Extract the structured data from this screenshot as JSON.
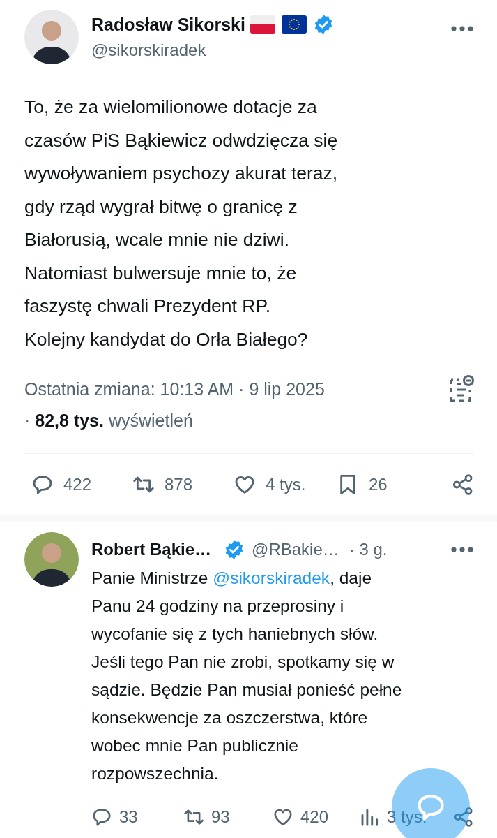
{
  "main_post": {
    "author": {
      "name": "Radosław Sikorski",
      "flags": [
        {
          "kind": "pl"
        },
        {
          "kind": "eu"
        }
      ],
      "verified": true,
      "handle": "@sikorskiradek"
    },
    "text": "To, że za wielomilionowe dotacje za\nczasów PiS Bąkiewicz odwdzięcza się\nwywoływaniem psychozy akurat teraz,\ngdy rząd wygrał bitwę o granicę z\nBiałorusią, wcale mnie nie dziwi.\nNatomiast bulwersuje mnie to, że\nfaszystę chwali Prezydent RP.\nKolejny kandydat do Orła Białego?",
    "timestamp": "Ostatnia zmiana: 10:13 AM · 9 lip 2025",
    "views": "· **82,8 tys.** wyświetleń",
    "actions": [
      {
        "kind": "reply",
        "count": "422"
      },
      {
        "kind": "repost",
        "count": "878"
      },
      {
        "kind": "like",
        "count": "4 tys."
      },
      {
        "kind": "bookmark",
        "count": "26"
      },
      {
        "kind": "share"
      }
    ]
  },
  "reply": {
    "author": {
      "name": "Robert Bąkie…",
      "verified": true,
      "handle": "@RBakie…",
      "time": "· 3 g."
    },
    "text_parts": [
      {
        "kind": "text",
        "text": "Panie Ministrze "
      },
      {
        "kind": "mention",
        "text": "@sikorskiradek"
      },
      {
        "kind": "text",
        "text": ", daje\nPanu 24 godziny na przeprosiny i\nwycofanie się z tych haniebnych słów.\nJeśli tego Pan nie zrobi, spotkamy się w\nsądzie. Będzie Pan musiał ponieść pełne\nkonsekwencje za oszczerstwa, które\nwobec mnie Pan publicznie\nrozpowszechnia."
      }
    ],
    "actions": [
      {
        "kind": "reply",
        "count": "33"
      },
      {
        "kind": "repost",
        "count": "93"
      },
      {
        "kind": "like",
        "count": "420"
      },
      {
        "kind": "views",
        "count": "3 tys."
      },
      {
        "kind": "share"
      }
    ]
  }
}
